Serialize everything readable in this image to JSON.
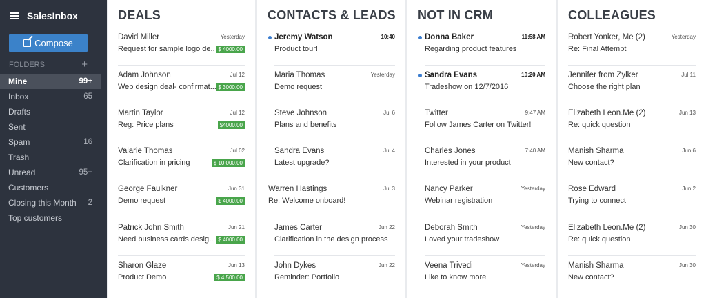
{
  "app": {
    "title": "SalesInbox"
  },
  "sidebar": {
    "compose_label": "Compose",
    "folders_heading": "FOLDERS",
    "add_label": "+",
    "folders": [
      {
        "label": "Mine",
        "count": "99+",
        "active": true
      },
      {
        "label": "Inbox",
        "count": "65"
      },
      {
        "label": "Drafts",
        "count": ""
      },
      {
        "label": "Sent",
        "count": ""
      },
      {
        "label": "Spam",
        "count": "16"
      },
      {
        "label": "Trash",
        "count": ""
      },
      {
        "label": "Unread",
        "count": "95+"
      },
      {
        "label": "Customers",
        "count": ""
      },
      {
        "label": "Closing this Month",
        "count": "2"
      },
      {
        "label": "Top customers",
        "count": ""
      }
    ]
  },
  "columns": [
    {
      "title": "DEALS",
      "items": [
        {
          "name": "David Miller",
          "date": "Yesterday",
          "subject": "Request for sample logo de..",
          "amount": "$ 4000.00"
        },
        {
          "name": "Adam Johnson",
          "date": "Jul 12",
          "subject": "Web design deal- confirmat...",
          "amount": "$ 3000.00"
        },
        {
          "name": "Martin Taylor",
          "date": "Jul 12",
          "subject": "Reg: Price plans",
          "amount": "$4000.00"
        },
        {
          "name": "Valarie Thomas",
          "date": "Jul 02",
          "subject": "Clarification in pricing",
          "amount": "$ 10,000.00"
        },
        {
          "name": "George Faulkner",
          "date": "Jun 31",
          "subject": "Demo request",
          "amount": "$ 4000.00"
        },
        {
          "name": "Patrick John Smith",
          "date": "Jun 21",
          "subject": "Need business cards desig..",
          "amount": "$ 4000.00"
        },
        {
          "name": "Sharon Glaze",
          "date": "Jun 13",
          "subject": "Product Demo",
          "amount": "$ 4,500.00"
        }
      ]
    },
    {
      "title": "CONTACTS & LEADS",
      "items": [
        {
          "name": "Jeremy Watson",
          "date": "10:40",
          "subject": "Product tour!",
          "unread": true
        },
        {
          "name": "Maria Thomas",
          "date": "Yesterday",
          "subject": "Demo request"
        },
        {
          "name": "Steve Johnson",
          "date": "Jul 6",
          "subject": "Plans and benefits"
        },
        {
          "name": "Sandra Evans",
          "date": "Jul 4",
          "subject": "Latest upgrade?"
        },
        {
          "name": "Warren Hastings",
          "date": "Jul 3",
          "subject": "Re: Welcome onboard!"
        },
        {
          "name": "James Carter",
          "date": "Jun 22",
          "subject": "Clarification in the design process"
        },
        {
          "name": "John Dykes",
          "date": "Jun 22",
          "subject": "Reminder: Portfolio"
        }
      ]
    },
    {
      "title": "NOT IN CRM",
      "items": [
        {
          "name": "Donna Baker",
          "date": "11:58 AM",
          "subject": "Regarding product features",
          "unread": true
        },
        {
          "name": "Sandra Evans",
          "date": "10:20 AM",
          "subject": "Tradeshow on 12/7/2016",
          "unread": true
        },
        {
          "name": "Twitter",
          "date": "9:47 AM",
          "subject": "Follow James Carter on Twitter!"
        },
        {
          "name": "Charles Jones",
          "date": "7:40 AM",
          "subject": "Interested in your product"
        },
        {
          "name": "Nancy Parker",
          "date": "Yesterday",
          "subject": "Webinar registration"
        },
        {
          "name": "Deborah Smith",
          "date": "Yesterday",
          "subject": "Loved your tradeshow"
        },
        {
          "name": "Veena Trivedi",
          "date": "Yesterday",
          "subject": "Like to know more"
        }
      ]
    },
    {
      "title": "COLLEAGUES",
      "items": [
        {
          "name": "Robert Yonker, Me (2)",
          "date": "Yesterday",
          "subject": "Re: Final Attempt"
        },
        {
          "name": "Jennifer from Zylker",
          "date": "Jul 11",
          "subject": "Choose the right plan"
        },
        {
          "name": "Elizabeth Leon.Me (2)",
          "date": "Jun 13",
          "subject": "Re: quick question"
        },
        {
          "name": "Manish Sharma",
          "date": "Jun 6",
          "subject": "New contact?"
        },
        {
          "name": "Rose Edward",
          "date": "Jun 2",
          "subject": "Trying to connect"
        },
        {
          "name": "Elizabeth Leon.Me (2)",
          "date": "Jun 30",
          "subject": "Re: quick question"
        },
        {
          "name": "Manish Sharma",
          "date": "Jun 30",
          "subject": "New contact?"
        }
      ]
    }
  ],
  "colors": {
    "sidebar_bg": "#2d333e",
    "accent": "#3b82c9",
    "amount_badge": "#49a54b",
    "unread_dot": "#3a7ccf"
  }
}
